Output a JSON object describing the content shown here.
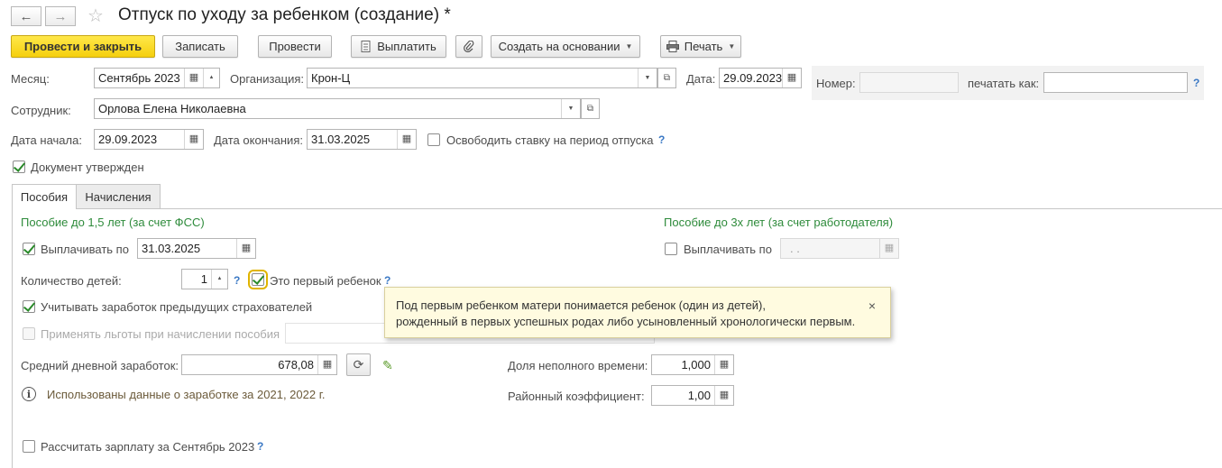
{
  "window": {
    "title": "Отпуск по уходу за ребенком (создание) *",
    "back_icon": "←",
    "forward_icon": "→",
    "star_icon": "☆"
  },
  "toolbar": {
    "post_close": "Провести и закрыть",
    "write": "Записать",
    "post": "Провести",
    "pay": "Выплатить",
    "create_based": "Создать на основании",
    "print": "Печать"
  },
  "header": {
    "month_label": "Месяц:",
    "month_value": "Сентябрь 2023",
    "org_label": "Организация:",
    "org_value": "Крон-Ц",
    "date_label": "Дата:",
    "date_value": "29.09.2023",
    "number_label": "Номер:",
    "number_value": "",
    "print_as_label": "печатать как:",
    "print_as_value": "",
    "employee_label": "Сотрудник:",
    "employee_value": "Орлова Елена Николаевна",
    "start_label": "Дата начала:",
    "start_value": "29.09.2023",
    "end_label": "Дата окончания:",
    "end_value": "31.03.2025",
    "free_rate_label": "Освободить ставку на период отпуска",
    "free_rate_checked": false,
    "approved_label": "Документ утвержден",
    "approved_checked": true
  },
  "tabs": [
    {
      "label": "Пособия",
      "active": true
    },
    {
      "label": "Начисления",
      "active": false
    }
  ],
  "benefits": {
    "left_title": "Пособие до 1,5 лет (за счет ФСС)",
    "right_title": "Пособие до 3х лет (за счет работодателя)",
    "pay_until_label": "Выплачивать по",
    "pay_until_value": "31.03.2025",
    "pay_until_checked": true,
    "pay_until3_label": "Выплачивать по",
    "pay_until3_value": ". .",
    "pay_until3_checked": false,
    "children_label": "Количество детей:",
    "children_value": "1",
    "first_child_label": "Это первый ребенок",
    "first_child_checked": true,
    "prev_insurers_label": "Учитывать заработок предыдущих страхователей",
    "prev_insurers_checked": true,
    "privileges_label": "Применять льготы при начислении пособия",
    "privileges_checked": false,
    "avg_earnings_label": "Средний дневной заработок:",
    "avg_earnings_value": "678,08",
    "part_time_label": "Доля неполного времени:",
    "part_time_value": "1,000",
    "region_coef_label": "Районный коэффициент:",
    "region_coef_value": "1,00",
    "info_text": "Использованы данные о заработке за  2021,  2022 г.",
    "calc_salary_label": "Рассчитать зарплату за Сентябрь 2023",
    "calc_salary_checked": false
  },
  "tooltip": {
    "line1": "Под первым ребенком матери понимается ребенок (один из детей),",
    "line2": "рожденный в первых успешных родах либо усыновленный хронологически первым.",
    "close": "×"
  },
  "help_mark": "?",
  "colors": {
    "primary_button": "#f5cf0e",
    "section_title": "#2e8b3b",
    "help": "#3a78c4",
    "tooltip_bg": "#fffbe0"
  }
}
